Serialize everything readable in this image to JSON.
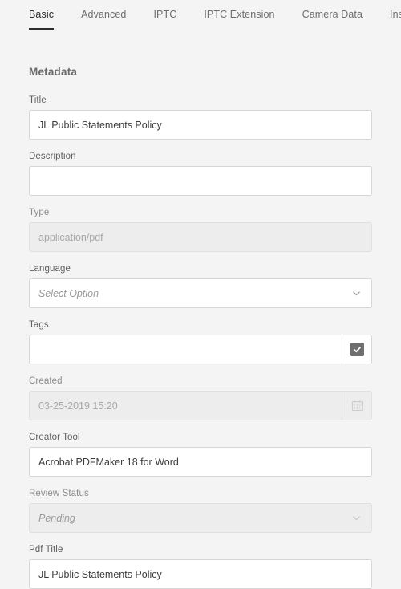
{
  "tabs": [
    {
      "label": "Basic",
      "active": true
    },
    {
      "label": "Advanced",
      "active": false
    },
    {
      "label": "IPTC",
      "active": false
    },
    {
      "label": "IPTC Extension",
      "active": false
    },
    {
      "label": "Camera Data",
      "active": false
    },
    {
      "label": "Insights",
      "active": false
    }
  ],
  "section": {
    "title": "Metadata"
  },
  "fields": {
    "title": {
      "label": "Title",
      "value": "JL Public Statements Policy"
    },
    "description": {
      "label": "Description",
      "value": ""
    },
    "type": {
      "label": "Type",
      "value": "application/pdf"
    },
    "language": {
      "label": "Language",
      "placeholder": "Select Option"
    },
    "tags": {
      "label": "Tags",
      "value": ""
    },
    "created": {
      "label": "Created",
      "value": "03-25-2019 15:20"
    },
    "creator_tool": {
      "label": "Creator Tool",
      "value": "Acrobat PDFMaker 18 for Word"
    },
    "review_status": {
      "label": "Review Status",
      "value": "Pending"
    },
    "pdf_title": {
      "label": "Pdf Title",
      "value": "JL Public Statements Policy"
    }
  },
  "icons": {
    "chevron": "chevron-down-icon",
    "checkbox": "checkbox-checked-icon",
    "calendar": "calendar-icon"
  },
  "colors": {
    "background": "#f4f4f4",
    "field_background": "#ffffff",
    "disabled_background": "#ededed",
    "border": "#d6d6d6",
    "text": "#3d3d3d",
    "muted_text": "#9a9a9a",
    "active_tab": "#2c2c2c"
  }
}
